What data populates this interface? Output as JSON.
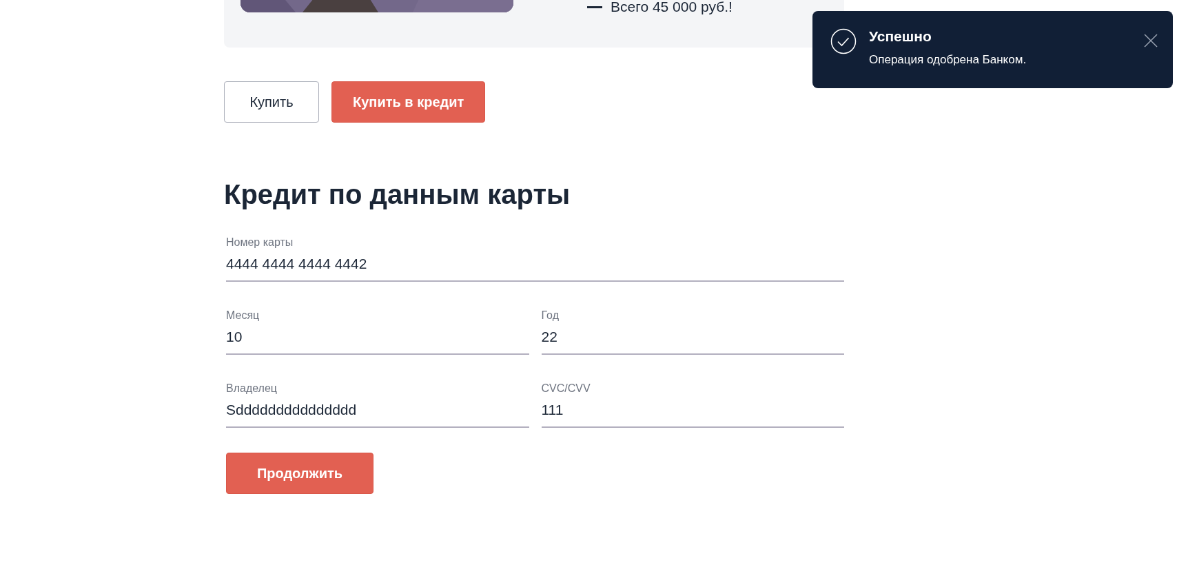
{
  "offer": {
    "total": "Всего 45 000 руб.!"
  },
  "buttons": [
    {
      "label": "Купить",
      "kind": "outline"
    },
    {
      "label": "Купить в кредит",
      "kind": "primary"
    }
  ],
  "form": {
    "title": "Кредит по данным карты",
    "rows": [
      [
        {
          "label": "Номер карты",
          "value": "4444 4444 4444 4442"
        }
      ],
      [
        {
          "label": "Месяц",
          "value": "10"
        },
        {
          "label": "Год",
          "value": "22"
        }
      ],
      [
        {
          "label": "Владелец",
          "value": "Sddddddddddddddd"
        },
        {
          "label": "CVC/CVV",
          "value": "111"
        }
      ]
    ],
    "submit": "Продолжить"
  },
  "toast": {
    "title": "Успешно",
    "message": "Операция одобрена Банком."
  }
}
